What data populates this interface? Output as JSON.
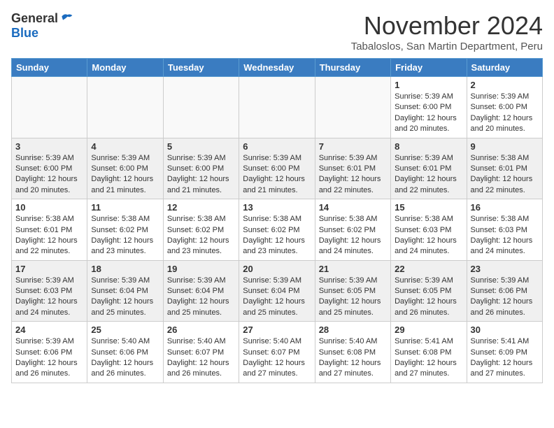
{
  "header": {
    "logo_general": "General",
    "logo_blue": "Blue",
    "month": "November 2024",
    "location": "Tabaloslos, San Martin Department, Peru"
  },
  "weekdays": [
    "Sunday",
    "Monday",
    "Tuesday",
    "Wednesday",
    "Thursday",
    "Friday",
    "Saturday"
  ],
  "weeks": [
    [
      {
        "day": "",
        "info": ""
      },
      {
        "day": "",
        "info": ""
      },
      {
        "day": "",
        "info": ""
      },
      {
        "day": "",
        "info": ""
      },
      {
        "day": "",
        "info": ""
      },
      {
        "day": "1",
        "info": "Sunrise: 5:39 AM\nSunset: 6:00 PM\nDaylight: 12 hours and 20 minutes."
      },
      {
        "day": "2",
        "info": "Sunrise: 5:39 AM\nSunset: 6:00 PM\nDaylight: 12 hours and 20 minutes."
      }
    ],
    [
      {
        "day": "3",
        "info": "Sunrise: 5:39 AM\nSunset: 6:00 PM\nDaylight: 12 hours and 20 minutes."
      },
      {
        "day": "4",
        "info": "Sunrise: 5:39 AM\nSunset: 6:00 PM\nDaylight: 12 hours and 21 minutes."
      },
      {
        "day": "5",
        "info": "Sunrise: 5:39 AM\nSunset: 6:00 PM\nDaylight: 12 hours and 21 minutes."
      },
      {
        "day": "6",
        "info": "Sunrise: 5:39 AM\nSunset: 6:00 PM\nDaylight: 12 hours and 21 minutes."
      },
      {
        "day": "7",
        "info": "Sunrise: 5:39 AM\nSunset: 6:01 PM\nDaylight: 12 hours and 22 minutes."
      },
      {
        "day": "8",
        "info": "Sunrise: 5:39 AM\nSunset: 6:01 PM\nDaylight: 12 hours and 22 minutes."
      },
      {
        "day": "9",
        "info": "Sunrise: 5:38 AM\nSunset: 6:01 PM\nDaylight: 12 hours and 22 minutes."
      }
    ],
    [
      {
        "day": "10",
        "info": "Sunrise: 5:38 AM\nSunset: 6:01 PM\nDaylight: 12 hours and 22 minutes."
      },
      {
        "day": "11",
        "info": "Sunrise: 5:38 AM\nSunset: 6:02 PM\nDaylight: 12 hours and 23 minutes."
      },
      {
        "day": "12",
        "info": "Sunrise: 5:38 AM\nSunset: 6:02 PM\nDaylight: 12 hours and 23 minutes."
      },
      {
        "day": "13",
        "info": "Sunrise: 5:38 AM\nSunset: 6:02 PM\nDaylight: 12 hours and 23 minutes."
      },
      {
        "day": "14",
        "info": "Sunrise: 5:38 AM\nSunset: 6:02 PM\nDaylight: 12 hours and 24 minutes."
      },
      {
        "day": "15",
        "info": "Sunrise: 5:38 AM\nSunset: 6:03 PM\nDaylight: 12 hours and 24 minutes."
      },
      {
        "day": "16",
        "info": "Sunrise: 5:38 AM\nSunset: 6:03 PM\nDaylight: 12 hours and 24 minutes."
      }
    ],
    [
      {
        "day": "17",
        "info": "Sunrise: 5:39 AM\nSunset: 6:03 PM\nDaylight: 12 hours and 24 minutes."
      },
      {
        "day": "18",
        "info": "Sunrise: 5:39 AM\nSunset: 6:04 PM\nDaylight: 12 hours and 25 minutes."
      },
      {
        "day": "19",
        "info": "Sunrise: 5:39 AM\nSunset: 6:04 PM\nDaylight: 12 hours and 25 minutes."
      },
      {
        "day": "20",
        "info": "Sunrise: 5:39 AM\nSunset: 6:04 PM\nDaylight: 12 hours and 25 minutes."
      },
      {
        "day": "21",
        "info": "Sunrise: 5:39 AM\nSunset: 6:05 PM\nDaylight: 12 hours and 25 minutes."
      },
      {
        "day": "22",
        "info": "Sunrise: 5:39 AM\nSunset: 6:05 PM\nDaylight: 12 hours and 26 minutes."
      },
      {
        "day": "23",
        "info": "Sunrise: 5:39 AM\nSunset: 6:06 PM\nDaylight: 12 hours and 26 minutes."
      }
    ],
    [
      {
        "day": "24",
        "info": "Sunrise: 5:39 AM\nSunset: 6:06 PM\nDaylight: 12 hours and 26 minutes."
      },
      {
        "day": "25",
        "info": "Sunrise: 5:40 AM\nSunset: 6:06 PM\nDaylight: 12 hours and 26 minutes."
      },
      {
        "day": "26",
        "info": "Sunrise: 5:40 AM\nSunset: 6:07 PM\nDaylight: 12 hours and 26 minutes."
      },
      {
        "day": "27",
        "info": "Sunrise: 5:40 AM\nSunset: 6:07 PM\nDaylight: 12 hours and 27 minutes."
      },
      {
        "day": "28",
        "info": "Sunrise: 5:40 AM\nSunset: 6:08 PM\nDaylight: 12 hours and 27 minutes."
      },
      {
        "day": "29",
        "info": "Sunrise: 5:41 AM\nSunset: 6:08 PM\nDaylight: 12 hours and 27 minutes."
      },
      {
        "day": "30",
        "info": "Sunrise: 5:41 AM\nSunset: 6:09 PM\nDaylight: 12 hours and 27 minutes."
      }
    ]
  ]
}
